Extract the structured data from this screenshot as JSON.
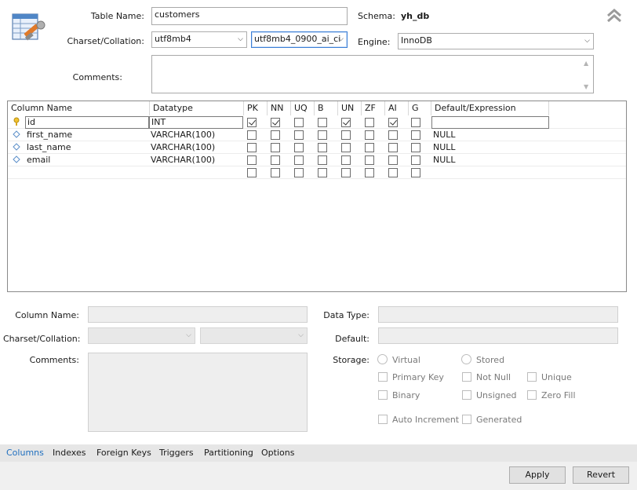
{
  "header": {
    "icon": "table-edit-icon",
    "table_name_label": "Table Name:",
    "table_name_value": "customers",
    "schema_label": "Schema:",
    "schema_value": "yh_db",
    "charset_label": "Charset/Collation:",
    "charset_value": "utf8mb4",
    "collation_value": "utf8mb4_0900_ai_ci",
    "engine_label": "Engine:",
    "engine_value": "InnoDB",
    "comments_label": "Comments:",
    "comments_value": "",
    "collapse_icon": "double-chevron-up-icon"
  },
  "grid": {
    "headers": [
      "Column Name",
      "Datatype",
      "PK",
      "NN",
      "UQ",
      "B",
      "UN",
      "ZF",
      "AI",
      "G",
      "Default/Expression"
    ],
    "rows": [
      {
        "icon": "key-icon",
        "name": "id",
        "type": "INT",
        "flags": [
          true,
          true,
          false,
          false,
          true,
          false,
          true,
          false
        ],
        "default": ""
      },
      {
        "icon": "diamond-icon",
        "name": "first_name",
        "type": "VARCHAR(100)",
        "flags": [
          false,
          false,
          false,
          false,
          false,
          false,
          false,
          false
        ],
        "default": "NULL"
      },
      {
        "icon": "diamond-icon",
        "name": "last_name",
        "type": "VARCHAR(100)",
        "flags": [
          false,
          false,
          false,
          false,
          false,
          false,
          false,
          false
        ],
        "default": "NULL"
      },
      {
        "icon": "diamond-icon",
        "name": "email",
        "type": "VARCHAR(100)",
        "flags": [
          false,
          false,
          false,
          false,
          false,
          false,
          false,
          false
        ],
        "default": "NULL"
      },
      {
        "icon": "",
        "name": "",
        "type": "",
        "flags": [
          false,
          false,
          false,
          false,
          false,
          false,
          false,
          false
        ],
        "default": ""
      }
    ]
  },
  "details": {
    "column_name_label": "Column Name:",
    "charset_label": "Charset/Collation:",
    "comments_label": "Comments:",
    "data_type_label": "Data Type:",
    "default_label": "Default:",
    "storage_label": "Storage:",
    "virtual_label": "Virtual",
    "stored_label": "Stored",
    "primary_key_label": "Primary Key",
    "not_null_label": "Not Null",
    "unique_label": "Unique",
    "binary_label": "Binary",
    "unsigned_label": "Unsigned",
    "zero_fill_label": "Zero Fill",
    "auto_increment_label": "Auto Increment",
    "generated_label": "Generated"
  },
  "tabs": [
    "Columns",
    "Indexes",
    "Foreign Keys",
    "Triggers",
    "Partitioning",
    "Options"
  ],
  "buttons": {
    "apply": "Apply",
    "revert": "Revert"
  },
  "colors": {
    "accent": "#1f6fbf",
    "tabbar": "#e6e6e6"
  }
}
